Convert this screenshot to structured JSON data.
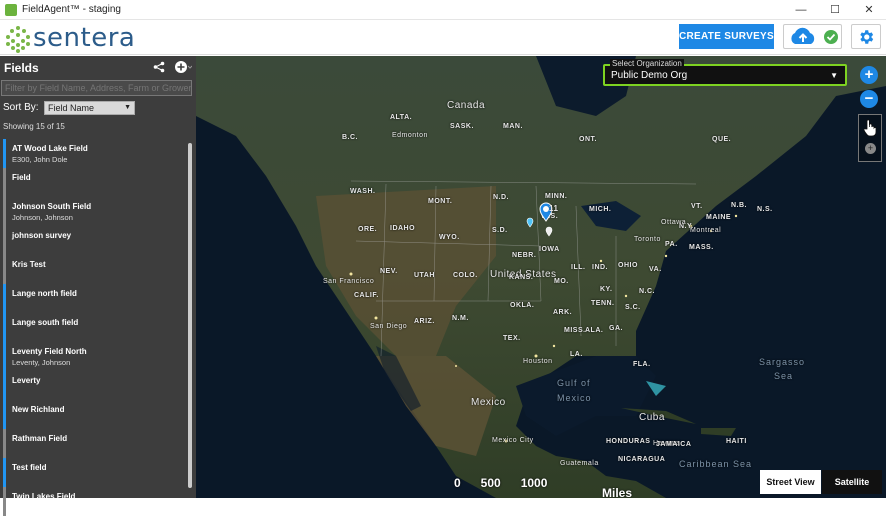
{
  "window": {
    "title": "FieldAgent™ - staging",
    "controls": [
      "—",
      "☐",
      "✕"
    ]
  },
  "header": {
    "logo_text": "sentera",
    "create_button": "CREATE SURVEYS",
    "icons": [
      "cloud-upload-icon",
      "check-icon",
      "gear-icon"
    ],
    "colors": {
      "brand_green": "#7ab648",
      "accent_blue": "#1e88e5",
      "ok_green": "#4caf50"
    }
  },
  "sidebar": {
    "title": "Fields",
    "filter_placeholder": "Filter by Field Name, Address, Farm or Grower",
    "sort_label": "Sort By:",
    "sort_value": "Field Name",
    "count_text": "Showing 15 of 15",
    "items": [
      {
        "name": "AT Wood Lake Field",
        "sub": "E300, John Dole",
        "accent": "blue"
      },
      {
        "name": "Field",
        "sub": "",
        "accent": "gray"
      },
      {
        "name": "Johnson South Field",
        "sub": "Johnson, Johnson",
        "accent": "gray"
      },
      {
        "name": "johnson survey",
        "sub": "",
        "accent": "gray"
      },
      {
        "name": "Kris Test",
        "sub": "",
        "accent": "gray"
      },
      {
        "name": "Lange north field",
        "sub": "",
        "accent": "blue"
      },
      {
        "name": "Lange south field",
        "sub": "",
        "accent": "blue"
      },
      {
        "name": "Leventy Field North",
        "sub": "Leventy, Johnson",
        "accent": "blue"
      },
      {
        "name": "Leverty",
        "sub": "",
        "accent": "blue"
      },
      {
        "name": "New Richland",
        "sub": "",
        "accent": "blue"
      },
      {
        "name": "Rathman Field",
        "sub": "",
        "accent": "gray"
      },
      {
        "name": "Test field",
        "sub": "",
        "accent": "blue"
      },
      {
        "name": "Twin Lakes Field",
        "sub": "",
        "accent": "gray"
      }
    ]
  },
  "map": {
    "org_label": "Select Organization",
    "org_value": "Public Demo Org",
    "zoom_in": "+",
    "zoom_out": "−",
    "scale_text": "0      500      1000",
    "scale_unit": "Miles",
    "street_view": "Street View",
    "satellite": "Satellite",
    "labels": {
      "canada": "Canada",
      "us": "United States",
      "mexico": "Mexico",
      "cuba": "Cuba",
      "gulf": "Gulf of",
      "gulf2": "Mexico",
      "sargasso": "Sargasso",
      "sargasso2": "Sea",
      "caribbean": "Caribbean Sea",
      "alta": "ALTA.",
      "sask": "SASK.",
      "man": "MAN.",
      "bc": "B.C.",
      "ont": "ONT.",
      "que": "QUE.",
      "nb": "N.B.",
      "ns": "N.S.",
      "edmonton": "Edmonton",
      "wash": "WASH.",
      "ore": "ORE.",
      "idaho": "IDAHO",
      "mont": "MONT.",
      "wyo": "WYO.",
      "nev": "NEV.",
      "utah": "UTAH",
      "colo": "COLO.",
      "calif": "CALIF.",
      "sf": "San Francisco",
      "sd": "San Diego",
      "ariz": "ARIZ.",
      "nm": "N.M.",
      "tex": "TEX.",
      "okla": "OKLA.",
      "kans": "KANS.",
      "nebr": "NEBR.",
      "sdak": "S.D.",
      "ndak": "N.D.",
      "minn": "MINN.",
      "iowa": "IOWA",
      "mo": "MO.",
      "ill": "ILL.",
      "ind": "IND.",
      "ohio": "OHIO",
      "mich": "MICH.",
      "wis": "WIS.",
      "ky": "KY.",
      "tenn": "TENN.",
      "ark": "ARK.",
      "miss": "MISS.",
      "ala": "ALA.",
      "ga": "GA.",
      "sc": "S.C.",
      "nc": "N.C.",
      "va": "VA.",
      "pa": "PA.",
      "ny": "N.Y.",
      "vt": "VT.",
      "maine": "MAINE",
      "mass": "MASS.",
      "fla": "FLA.",
      "la": "LA.",
      "houston": "Houston",
      "toronto": "Toronto",
      "ottawa": "Ottawa",
      "montreal": "Montreal",
      "mexico_city": "Mexico City",
      "havana": "Havana",
      "guatemala": "Guatemala",
      "honduras": "HONDURAS",
      "nicaragua": "NICARAGUA",
      "jamaica": "JAMAICA",
      "haiti": "HAITI"
    },
    "cluster_count": "11"
  }
}
